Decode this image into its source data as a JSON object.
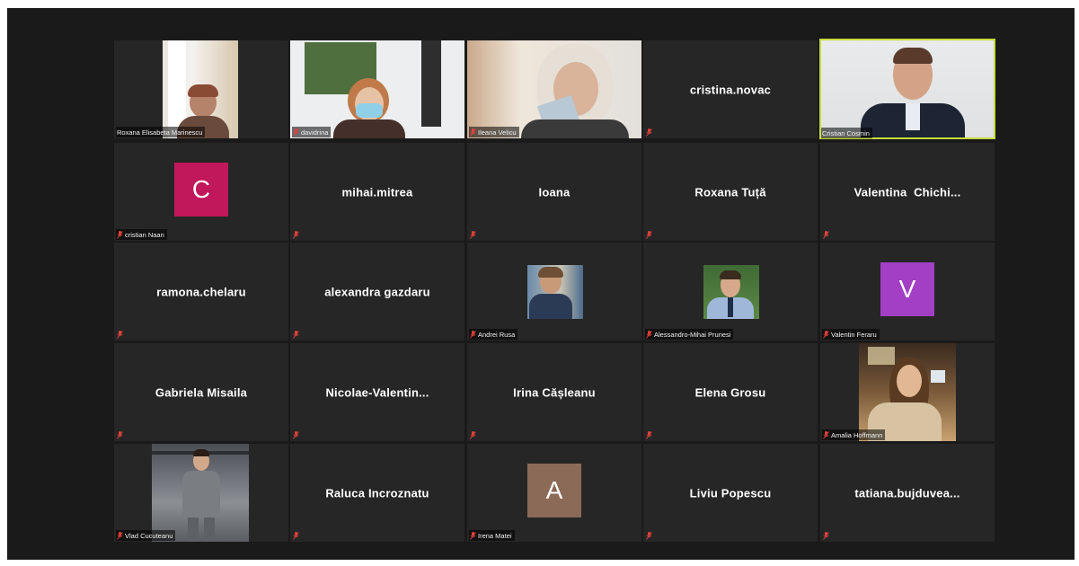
{
  "colors": {
    "background": "#1a1a1a",
    "tile": "#262626",
    "active_speaker_border": "#c8dc3c",
    "muted_mic": "#e0413b"
  },
  "participants": [
    {
      "label": "Roxana Elisabeta Marinescu",
      "video": true
    },
    {
      "label": "davidrina",
      "video": true
    },
    {
      "label": "Ileana Velicu",
      "video": true
    },
    {
      "name": "cristina.novac",
      "video": false
    },
    {
      "label": "Cristian Cosmin",
      "video": true,
      "active_speaker": true
    },
    {
      "label": "cristian Naan",
      "avatar": "C",
      "avatar_color": "#c0185a"
    },
    {
      "name": "mihai.mitrea"
    },
    {
      "name": "Ioana"
    },
    {
      "name": "Roxana Tuță"
    },
    {
      "name": "Valentina  Chichi..."
    },
    {
      "name": "ramona.chelaru"
    },
    {
      "name": "alexandra gazdaru"
    },
    {
      "label": "Andrei Rusa",
      "photo": true
    },
    {
      "label": "Alessandro-Mihai Prunesi",
      "photo": true
    },
    {
      "label": "Valentin Feraru",
      "avatar": "V",
      "avatar_color": "#a23fc4"
    },
    {
      "name": "Gabriela Misaila"
    },
    {
      "name": "Nicolae-Valentin..."
    },
    {
      "name": "Irina Cășleanu"
    },
    {
      "name": "Elena Grosu"
    },
    {
      "label": "Amalia Hoffmann",
      "photo": true
    },
    {
      "label": "Vlad Cucuteanu",
      "photo": true
    },
    {
      "name": "Raluca Incroznatu"
    },
    {
      "label": "Irena Matei",
      "avatar": "A",
      "avatar_color": "#8b6a58"
    },
    {
      "name": "Liviu Popescu"
    },
    {
      "name": "tatiana.bujduvea..."
    }
  ]
}
